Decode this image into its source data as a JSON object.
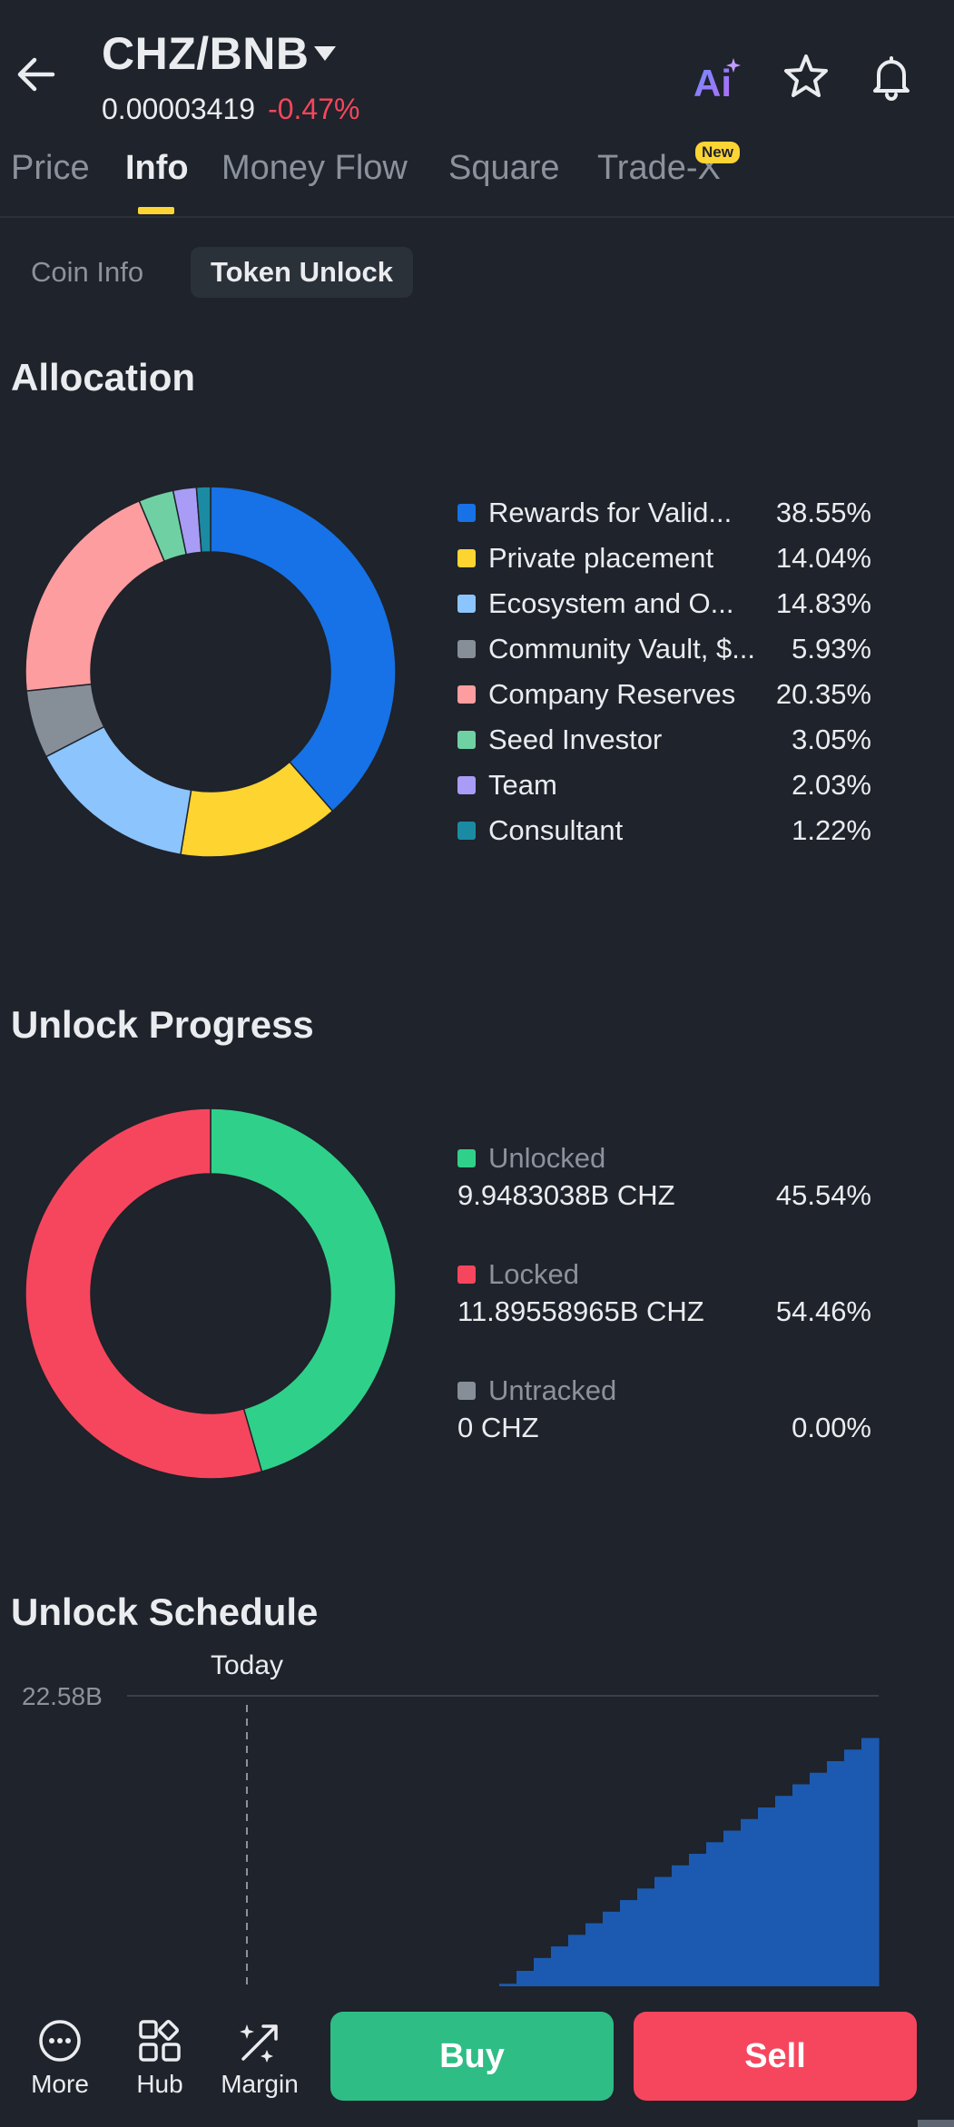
{
  "header": {
    "pair": "CHZ/BNB",
    "price": "0.00003419",
    "change": "-0.47%",
    "ai_label": "Ai"
  },
  "tabs": [
    {
      "label": "Price",
      "active": false
    },
    {
      "label": "Info",
      "active": true
    },
    {
      "label": "Money Flow",
      "active": false
    },
    {
      "label": "Square",
      "active": false
    },
    {
      "label": "Trade-X",
      "active": false,
      "badge": "New"
    }
  ],
  "subtabs": [
    {
      "label": "Coin Info",
      "active": false
    },
    {
      "label": "Token Unlock",
      "active": true
    }
  ],
  "allocation": {
    "title": "Allocation",
    "items": [
      {
        "label": "Rewards for Valid...",
        "pct": "38.55%",
        "value": 38.55,
        "color": "#1672e6"
      },
      {
        "label": "Private placement",
        "pct": "14.04%",
        "value": 14.04,
        "color": "#fdd430"
      },
      {
        "label": "Ecosystem and O...",
        "pct": "14.83%",
        "value": 14.83,
        "color": "#8cc4fe"
      },
      {
        "label": "Community Vault, $...",
        "pct": "5.93%",
        "value": 5.93,
        "color": "#868e98"
      },
      {
        "label": "Company Reserves",
        "pct": "20.35%",
        "value": 20.35,
        "color": "#fd9d9f"
      },
      {
        "label": "Seed Investor",
        "pct": "3.05%",
        "value": 3.05,
        "color": "#6fd1a3"
      },
      {
        "label": "Team",
        "pct": "2.03%",
        "value": 2.03,
        "color": "#a99cf6"
      },
      {
        "label": "Consultant",
        "pct": "1.22%",
        "value": 1.22,
        "color": "#1b8ba3"
      }
    ]
  },
  "unlock_progress": {
    "title": "Unlock Progress",
    "items": [
      {
        "label": "Unlocked",
        "amount": "9.9483038B CHZ",
        "pct": "45.54%",
        "value": 45.54,
        "color": "#2fd18a"
      },
      {
        "label": "Locked",
        "amount": "11.89558965B CHZ",
        "pct": "54.46%",
        "value": 54.46,
        "color": "#f6465d"
      },
      {
        "label": "Untracked",
        "amount": "0 CHZ",
        "pct": "0.00%",
        "value": 0,
        "color": "#868e98"
      }
    ]
  },
  "unlock_schedule": {
    "title": "Unlock Schedule",
    "y_max_label": "22.58B",
    "today_label": "Today",
    "fill_color": "#1b5ab0"
  },
  "chart_data": [
    {
      "type": "pie",
      "title": "Allocation",
      "categories": [
        "Rewards for Valid...",
        "Private placement",
        "Ecosystem and O...",
        "Community Vault, $...",
        "Company Reserves",
        "Seed Investor",
        "Team",
        "Consultant"
      ],
      "values": [
        38.55,
        14.04,
        14.83,
        5.93,
        20.35,
        3.05,
        2.03,
        1.22
      ]
    },
    {
      "type": "pie",
      "title": "Unlock Progress",
      "categories": [
        "Unlocked",
        "Locked",
        "Untracked"
      ],
      "values": [
        45.54,
        54.46,
        0
      ]
    },
    {
      "type": "area",
      "title": "Unlock Schedule",
      "ylim": [
        0,
        22.58
      ],
      "ylabel": "",
      "xlabel": "",
      "annotation": "Today",
      "step_values": [
        0.2,
        1.2,
        2.2,
        3.1,
        4.0,
        4.9,
        5.8,
        6.7,
        7.6,
        8.5,
        9.4,
        10.3,
        11.2,
        12.1,
        13.0,
        13.9,
        14.8,
        15.7,
        16.6,
        17.5,
        18.4,
        19.3
      ]
    }
  ],
  "bottom_bar": {
    "more": "More",
    "hub": "Hub",
    "margin": "Margin",
    "buy": "Buy",
    "sell": "Sell"
  }
}
